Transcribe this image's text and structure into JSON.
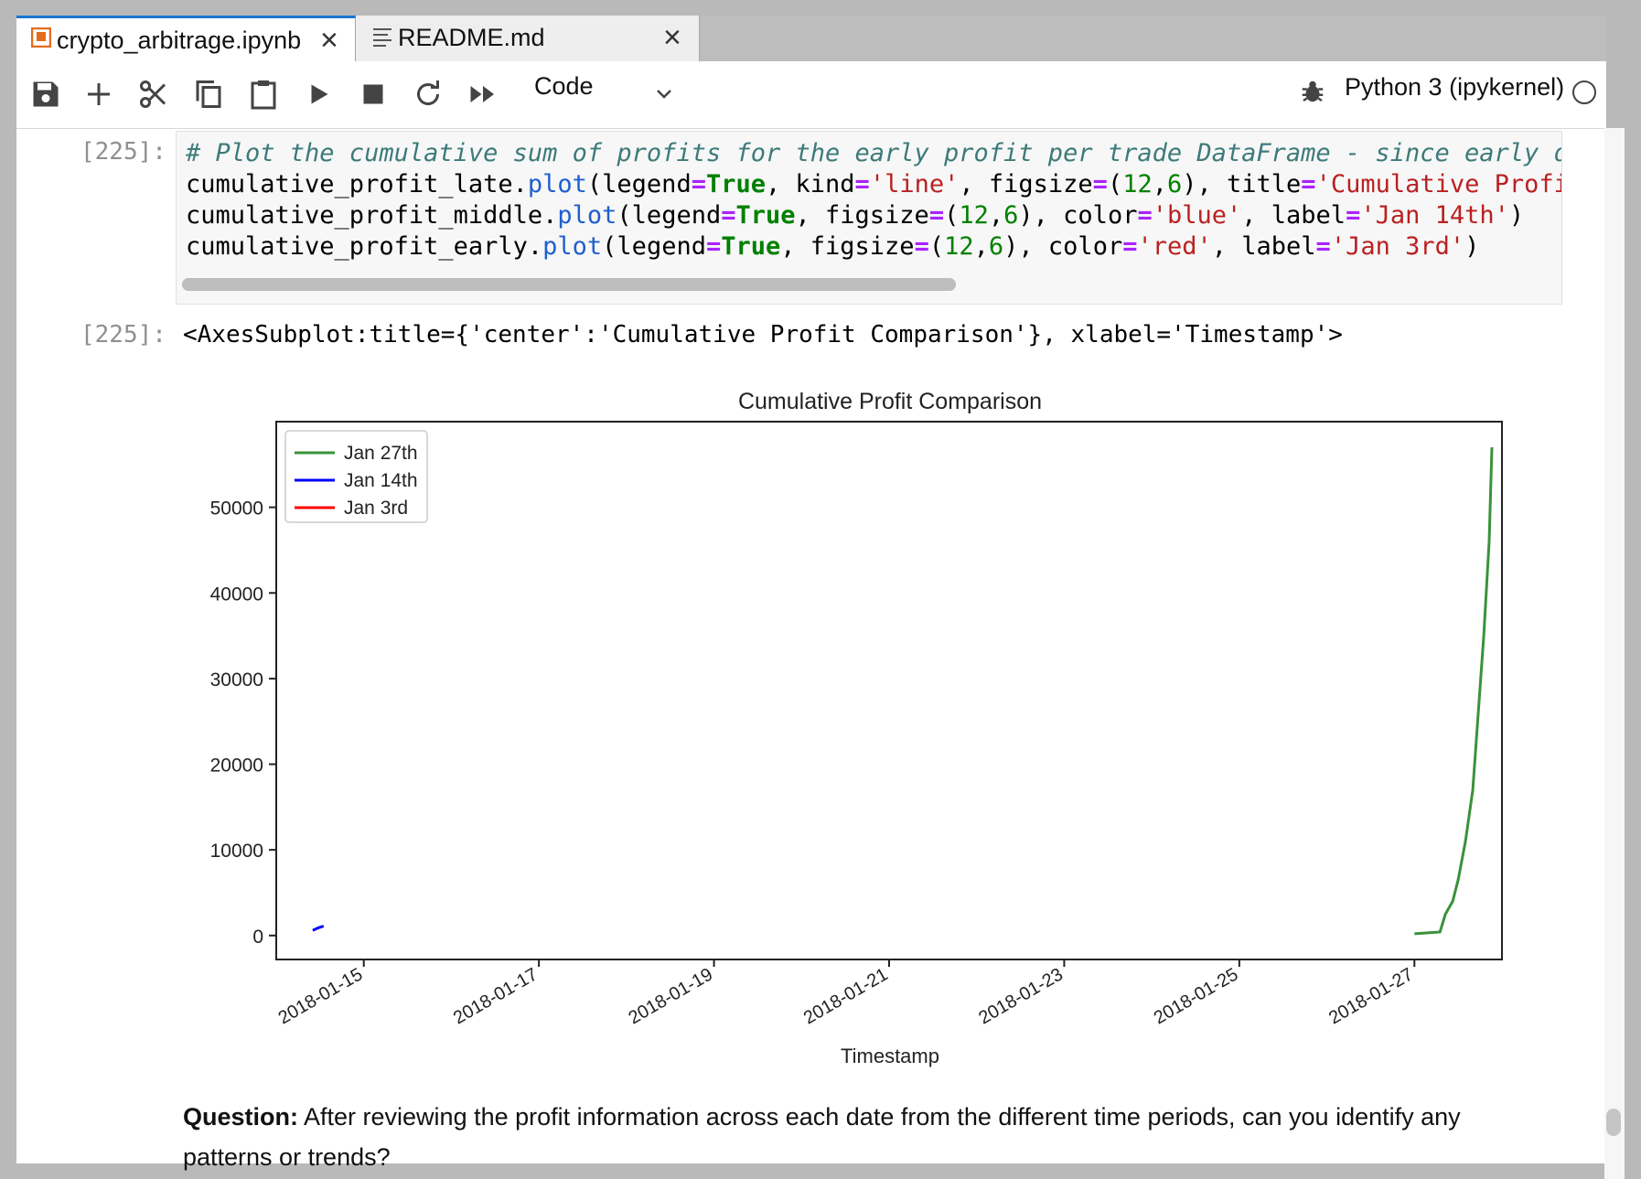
{
  "tabs": [
    {
      "label": "crypto_arbitrage.ipynb",
      "icon": "notebook-icon",
      "active": true
    },
    {
      "label": "README.md",
      "icon": "text-file-icon",
      "active": false
    }
  ],
  "toolbar": {
    "cell_type": "Code",
    "kernel": "Python 3 (ipykernel)"
  },
  "cells": {
    "input_prompt": "[225]:",
    "output_prompt": "[225]:",
    "code": {
      "l1": "# Plot the cumulative sum of profits for the early profit per trade DataFrame - since early did",
      "l2": {
        "a": "cumulative_profit_late.",
        "fn": "plot",
        "b": "(legend",
        "eq1": "=",
        "t1": "True",
        "c": ", kind",
        "eq2": "=",
        "s1": "'line'",
        "d": ", figsize",
        "eq3": "=",
        "e": "(",
        "n1": "12",
        "f": ",",
        "n2": "6",
        "g": "), title",
        "eq4": "=",
        "s2": "'Cumulative Profit C"
      },
      "l3": {
        "a": "cumulative_profit_middle.",
        "fn": "plot",
        "b": "(legend",
        "eq1": "=",
        "t1": "True",
        "c": ", figsize",
        "eq2": "=",
        "d": "(",
        "n1": "12",
        "e": ",",
        "n2": "6",
        "f": "), color",
        "eq3": "=",
        "s1": "'blue'",
        "g": ", label",
        "eq4": "=",
        "s2": "'Jan 14th'",
        "h": ")"
      },
      "l4": {
        "a": "cumulative_profit_early.",
        "fn": "plot",
        "b": "(legend",
        "eq1": "=",
        "t1": "True",
        "c": ", figsize",
        "eq2": "=",
        "d": "(",
        "n1": "12",
        "e": ",",
        "n2": "6",
        "f": "), color",
        "eq3": "=",
        "s1": "'red'",
        "g": ", label",
        "eq4": "=",
        "s2": "'Jan 3rd'",
        "h": ")"
      }
    },
    "output_text": "<AxesSubplot:title={'center':'Cumulative Profit Comparison'}, xlabel='Timestamp'>"
  },
  "chart_data": {
    "type": "line",
    "title": "Cumulative Profit Comparison",
    "xlabel": "Timestamp",
    "ylabel": "",
    "x_range": [
      "2018-01-14",
      "2018-01-28"
    ],
    "ylim": [
      -2800,
      60000
    ],
    "yticks": [
      0,
      10000,
      20000,
      30000,
      40000,
      50000
    ],
    "xticks": [
      "2018-01-15",
      "2018-01-17",
      "2018-01-19",
      "2018-01-21",
      "2018-01-23",
      "2018-01-25",
      "2018-01-27"
    ],
    "legend": "upper-left",
    "series": [
      {
        "name": "Jan 27th",
        "color": "#3a923a",
        "points": [
          [
            "2018-01-27T00:00",
            200
          ],
          [
            "2018-01-27T07:00",
            400
          ],
          [
            "2018-01-27T08:30",
            2500
          ],
          [
            "2018-01-27T10:30",
            4000
          ],
          [
            "2018-01-27T12:00",
            6500
          ],
          [
            "2018-01-27T14:00",
            11000
          ],
          [
            "2018-01-27T16:00",
            17000
          ],
          [
            "2018-01-27T17:30",
            26000
          ],
          [
            "2018-01-27T19:00",
            35000
          ],
          [
            "2018-01-27T20:30",
            46000
          ],
          [
            "2018-01-27T21:15",
            57000
          ]
        ]
      },
      {
        "name": "Jan 14th",
        "color": "#0000ff",
        "points": [
          [
            "2018-01-14T10:00",
            600
          ],
          [
            "2018-01-14T11:30",
            900
          ],
          [
            "2018-01-14T13:00",
            1100
          ]
        ]
      },
      {
        "name": "Jan 3rd",
        "color": "#ff0000",
        "points": []
      }
    ]
  },
  "markdown": {
    "bold": "Question:",
    "text": " After reviewing the profit information across each date from the different time periods, can you identify any patterns or trends?"
  }
}
